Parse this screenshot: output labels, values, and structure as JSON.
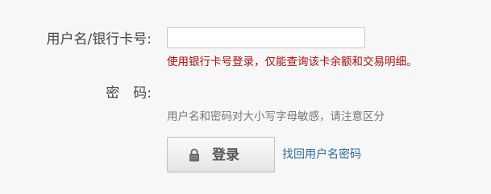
{
  "form": {
    "username_label": "用户名/银行卡号:",
    "username_value": "",
    "username_hint": "使用银行卡号登录，仅能查询该卡余额和交易明细。",
    "password_label": "密　码:",
    "password_hint": "用户名和密码对大小写字母敏感，请注意区分"
  },
  "actions": {
    "login_label": "登录",
    "login_icon": "lock-icon",
    "recover_link": "找回用户名密码"
  },
  "colors": {
    "hint_red": "#a80f0f",
    "link_blue": "#2a6b9a",
    "label_text": "#444444"
  }
}
